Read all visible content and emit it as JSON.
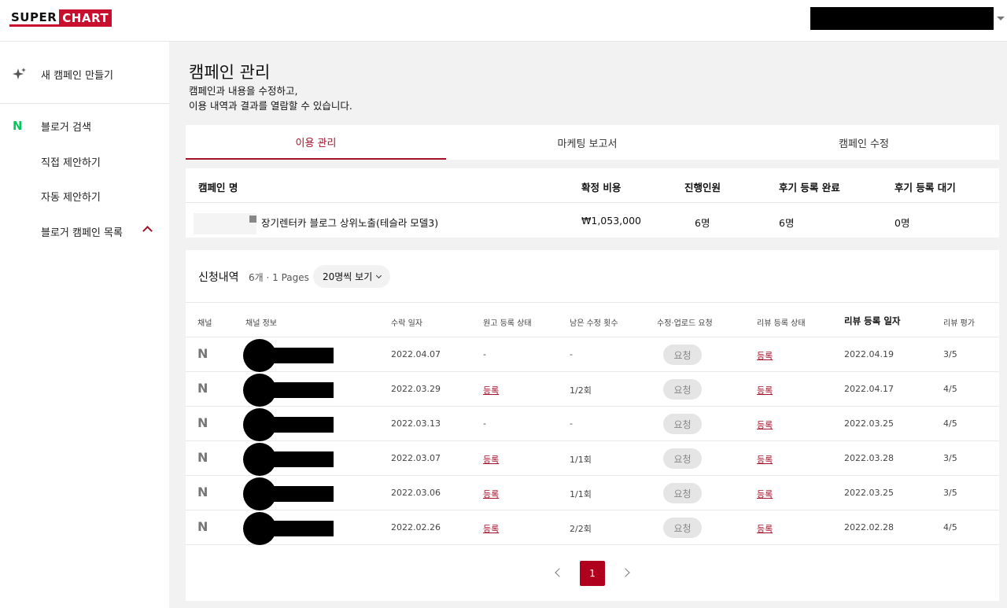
{
  "header": {
    "logo_part1": "SUPER",
    "logo_part2": "CHART",
    "brand_color": "#c8102e"
  },
  "sidebar": {
    "new_campaign": "새 캠페인 만들기",
    "naver_search": "블로거 검색",
    "direct_offer": "직접 제안하기",
    "auto_offer": "자동 제안하기",
    "campaign_list": "블로거 캠페인 목록"
  },
  "page": {
    "title": "캠페인 관리",
    "desc_line1": "캠페인과 내용을 수정하고,",
    "desc_line2": "이용 내역과 결과를 열람할 수 있습니다."
  },
  "tabs": [
    {
      "label": "이용 관리",
      "active": true
    },
    {
      "label": "마케팅 보고서",
      "active": false
    },
    {
      "label": "캠페인 수정",
      "active": false
    }
  ],
  "summary": {
    "headers": {
      "name": "캠페인 명",
      "cost": "확정 비용",
      "people": "진행인원",
      "done": "후기 등록 완료",
      "waiting": "후기 등록 대기"
    },
    "row": {
      "name": "장기렌터카 블로그 상위노출(테슬라 모델3)",
      "cost": "₩1,053,000",
      "people": "6명",
      "done": "6명",
      "waiting": "0명"
    }
  },
  "history": {
    "title": "신청내역",
    "count": "6개 · 1 Pages",
    "per_page": "20명씩 보기",
    "columns": {
      "channel": "채널",
      "channel_info": "채널 정보",
      "accept_date": "수락 일자",
      "draft_status": "원고 등록 상태",
      "remaining_edits": "남은 수정 횟수",
      "edit_upload_request": "수정·업로드 요청",
      "review_status": "리뷰 등록 상태",
      "review_date": "리뷰 등록 일자",
      "review_rating": "리뷰 평가"
    },
    "rows": [
      {
        "channel_icon": "naver-n-icon",
        "accept_date": "2022.04.07",
        "draft_status": "-",
        "remaining_edits": "-",
        "request": "요청",
        "review_status": "등록",
        "review_date": "2022.04.19",
        "rating": "3/5"
      },
      {
        "channel_icon": "naver-n-icon",
        "accept_date": "2022.03.29",
        "draft_status": "등록",
        "remaining_edits": "1/2회",
        "request": "요청",
        "review_status": "등록",
        "review_date": "2022.04.17",
        "rating": "4/5"
      },
      {
        "channel_icon": "naver-n-icon",
        "accept_date": "2022.03.13",
        "draft_status": "-",
        "remaining_edits": "-",
        "request": "요청",
        "review_status": "등록",
        "review_date": "2022.03.25",
        "rating": "4/5"
      },
      {
        "channel_icon": "naver-n-icon",
        "accept_date": "2022.03.07",
        "draft_status": "등록",
        "remaining_edits": "1/1회",
        "request": "요청",
        "review_status": "등록",
        "review_date": "2022.03.28",
        "rating": "3/5"
      },
      {
        "channel_icon": "naver-n-icon",
        "accept_date": "2022.03.06",
        "draft_status": "등록",
        "remaining_edits": "1/1회",
        "request": "요청",
        "review_status": "등록",
        "review_date": "2022.03.25",
        "rating": "3/5"
      },
      {
        "channel_icon": "naver-n-icon",
        "accept_date": "2022.02.26",
        "draft_status": "등록",
        "remaining_edits": "2/2회",
        "request": "요청",
        "review_status": "등록",
        "review_date": "2022.02.28",
        "rating": "4/5"
      }
    ],
    "pagination": {
      "current_page": "1"
    }
  }
}
